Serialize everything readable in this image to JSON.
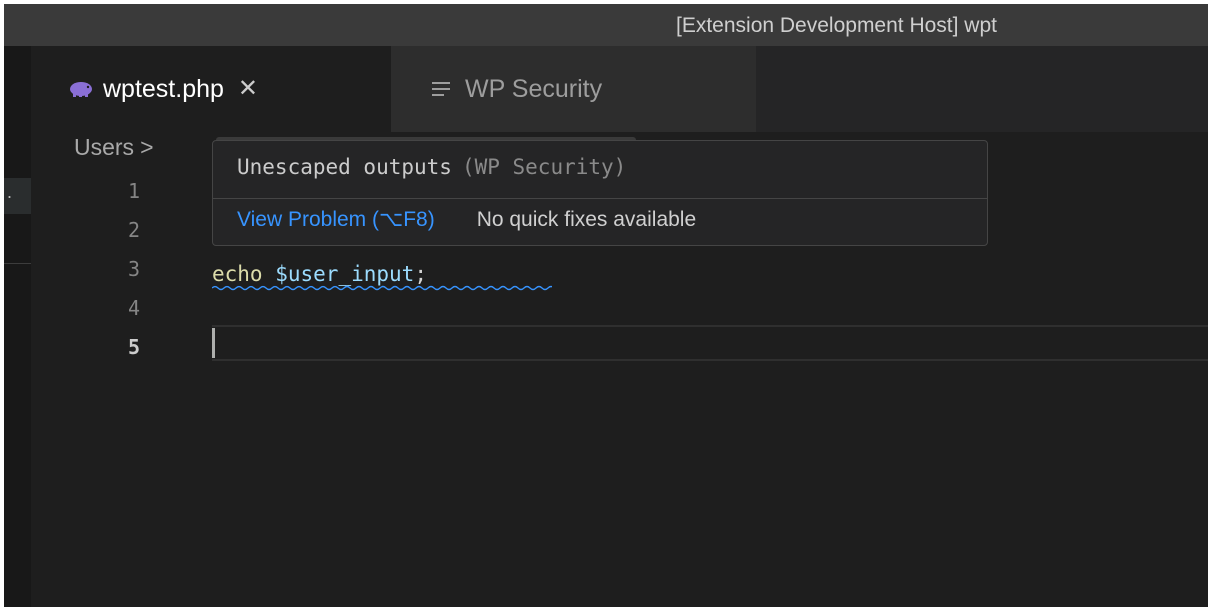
{
  "window": {
    "title": "[Extension Development Host] wpt"
  },
  "tabs": [
    {
      "label": "wptest.php",
      "icon": "php-elephant-icon",
      "active": true,
      "close": "✕"
    },
    {
      "label": "WP Security",
      "icon": "preview-lines-icon",
      "active": false
    }
  ],
  "breadcrumb": {
    "first": "Users",
    "separator": ">"
  },
  "left_panel": {
    "ellipsis": "."
  },
  "editor": {
    "line_numbers": [
      "1",
      "2",
      "3",
      "4",
      "5"
    ],
    "current_line": 5,
    "code_line_3": {
      "keyword": "echo",
      "variable": "$user_input",
      "punct": ";"
    }
  },
  "hover": {
    "message": "Unescaped outputs",
    "source": "(WP Security)",
    "view_problem": "View Problem (⌥F8)",
    "no_fixes": "No quick fixes available"
  },
  "colors": {
    "editor_bg": "#1e1e1e",
    "link": "#3794ff",
    "squiggle": "#3794ff",
    "php_icon": "#8a6fd6"
  }
}
